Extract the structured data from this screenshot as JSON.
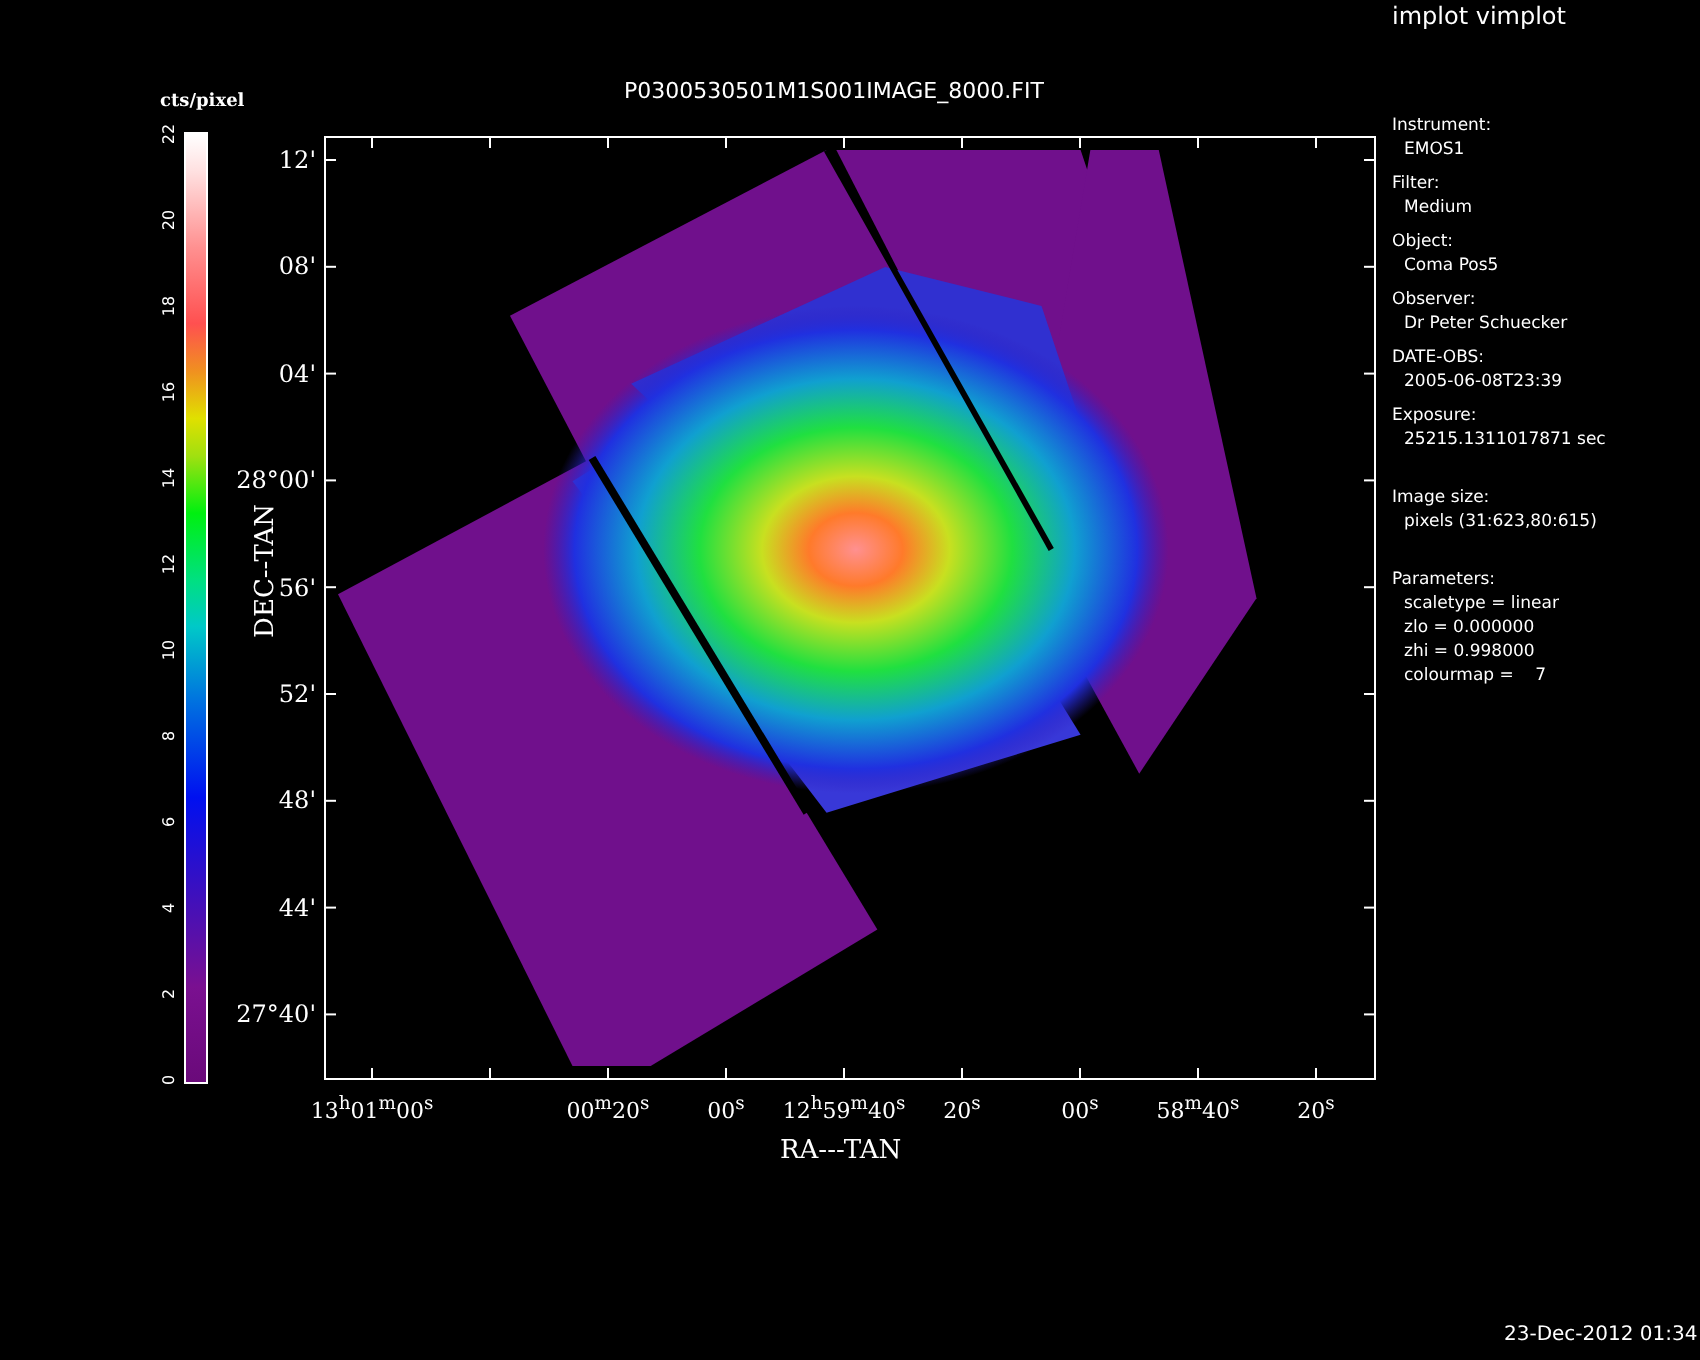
{
  "window": {
    "title": "implot vimplot"
  },
  "plot": {
    "title": "P0300530501M1S001IMAGE_8000.FIT",
    "xlabel": "RA---TAN",
    "ylabel": "DEC--TAN",
    "xticks": [
      "13$^{h}$01$^{m}$00$^{s}$",
      "00$^{m}$20$^{s}$",
      "00$^{s}$",
      "12$^{h}$59$^{m}$40$^{s}$",
      "20$^{s}$",
      "00$^{s}$",
      "58$^{m}$40$^{s}$",
      "20$^{s}$"
    ],
    "yticks": [
      "12'",
      "08'",
      "04'",
      "28°00'",
      "56'",
      "52'",
      "48'",
      "44'",
      "27°40'"
    ]
  },
  "colorbar": {
    "label": "cts/pixel",
    "ticks": [
      "0",
      "2",
      "4",
      "6",
      "8",
      "10",
      "12",
      "14",
      "16",
      "18",
      "20",
      "22"
    ]
  },
  "info": [
    {
      "heading": "Instrument:",
      "lines": [
        "EMOS1"
      ]
    },
    {
      "heading": "Filter:",
      "lines": [
        "Medium"
      ]
    },
    {
      "heading": "Object:",
      "lines": [
        "Coma Pos5"
      ]
    },
    {
      "heading": "Observer:",
      "lines": [
        "Dr Peter Schuecker"
      ]
    },
    {
      "heading": "DATE-OBS:",
      "lines": [
        "2005-06-08T23:39"
      ]
    },
    {
      "heading": "Exposure:",
      "lines": [
        "25215.1311017871 sec"
      ]
    },
    {
      "heading": "Image size:",
      "lines": [
        "pixels (31:623,80:615)"
      ]
    },
    {
      "heading": "Parameters:",
      "lines": [
        "scaletype = linear",
        "zlo = 0.000000",
        "zhi = 0.998000",
        "colourmap =    7"
      ]
    }
  ],
  "timestamp": "23-Dec-2012 01:34"
}
